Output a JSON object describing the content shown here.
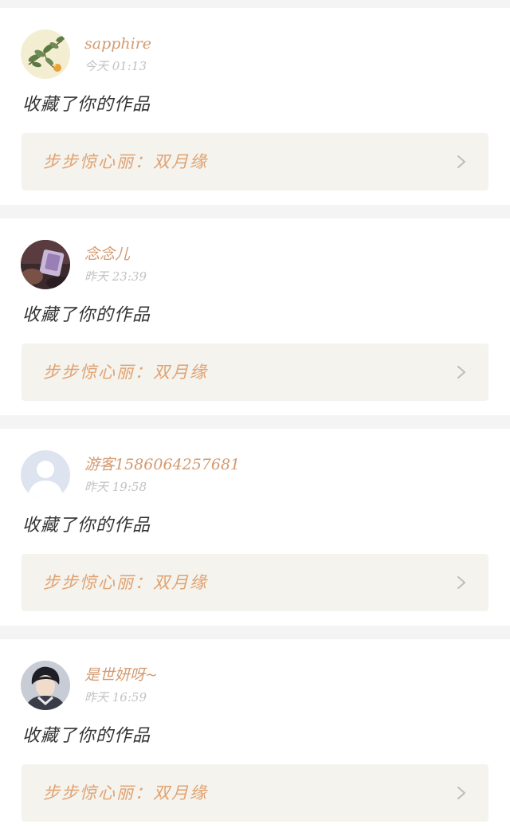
{
  "notifications": [
    {
      "username": "sapphire",
      "time": "今天 01:13",
      "action": "收藏了你的作品",
      "work_title": "步步惊心丽：双月缘",
      "avatar_icon": "flower-branch-avatar-icon"
    },
    {
      "username": "念念儿",
      "time": "昨天 23:39",
      "action": "收藏了你的作品",
      "work_title": "步步惊心丽：双月缘",
      "avatar_icon": "photo-avatar-icon"
    },
    {
      "username": "游客1586064257681",
      "time": "昨天 19:58",
      "action": "收藏了你的作品",
      "work_title": "步步惊心丽：双月缘",
      "avatar_icon": "default-user-avatar-icon"
    },
    {
      "username": "是世妍呀~",
      "time": "昨天 16:59",
      "action": "收藏了你的作品",
      "work_title": "步步惊心丽：双月缘",
      "avatar_icon": "portrait-avatar-icon"
    }
  ],
  "colors": {
    "username": "#d39a70",
    "work_title": "#e0a270",
    "timestamp": "#c2c2c2",
    "action_text": "#333333",
    "work_link_bg": "#f4f3ee",
    "page_bg": "#f4f4f4"
  }
}
